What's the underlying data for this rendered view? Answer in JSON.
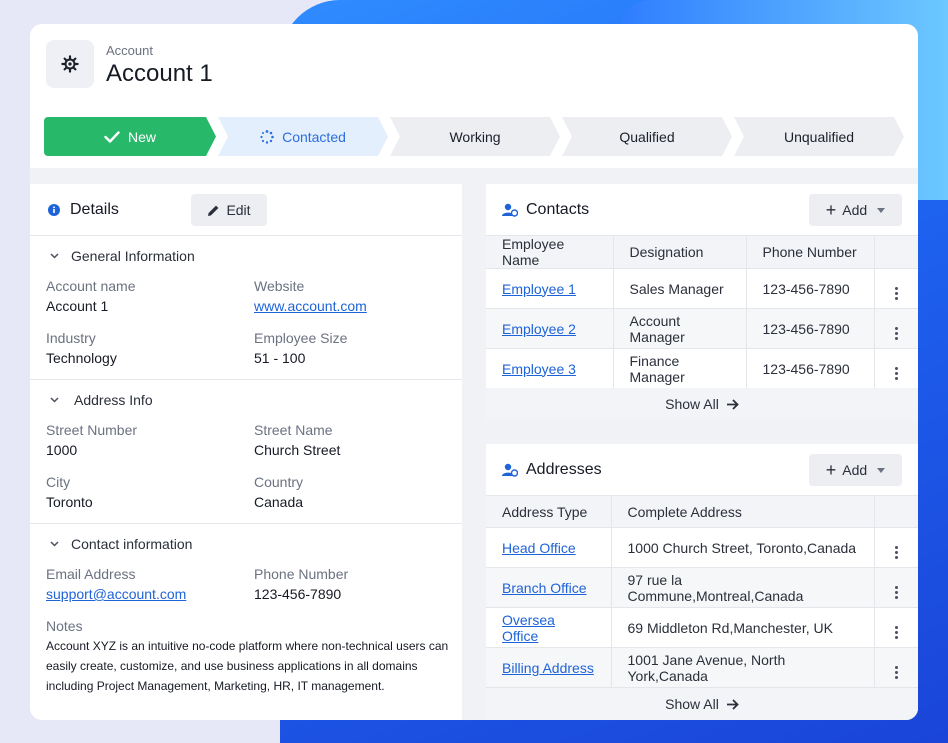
{
  "header": {
    "subtitle": "Account",
    "title": "Account 1"
  },
  "stages": [
    "New",
    "Contacted",
    "Working",
    "Qualified",
    "Unqualified"
  ],
  "details": {
    "title": "Details",
    "edit_label": "Edit",
    "general": {
      "heading": "General Information",
      "account_name_label": "Account name",
      "account_name": "Account 1",
      "website_label": "Website",
      "website": "www.account.com",
      "industry_label": "Industry",
      "industry": "Technology",
      "employee_size_label": "Employee Size",
      "employee_size": "51 - 100"
    },
    "address": {
      "heading": "Address Info",
      "street_number_label": "Street Number",
      "street_number": "1000",
      "street_name_label": "Street Name",
      "street_name": "Church Street",
      "city_label": "City",
      "city": "Toronto",
      "country_label": "Country",
      "country": "Canada"
    },
    "contact": {
      "heading": "Contact information",
      "email_label": "Email Address",
      "email": "support@account.com",
      "phone_label": "Phone Number",
      "phone": "123-456-7890",
      "notes_label": "Notes",
      "notes": "Account XYZ is an intuitive no-code platform where non-technical users can easily create, customize, and use business applications in all domains including Project Management, Marketing, HR, IT management."
    }
  },
  "contacts": {
    "title": "Contacts",
    "add_label": "Add",
    "columns": [
      "Employee Name",
      "Designation",
      "Phone Number"
    ],
    "rows": [
      {
        "name": "Employee 1",
        "designation": "Sales Manager",
        "phone": "123-456-7890"
      },
      {
        "name": "Employee 2",
        "designation": "Account Manager",
        "phone": "123-456-7890"
      },
      {
        "name": "Employee 3",
        "designation": "Finance Manager",
        "phone": "123-456-7890"
      }
    ],
    "show_all": "Show All"
  },
  "addresses": {
    "title": "Addresses",
    "add_label": "Add",
    "columns": [
      "Address Type",
      "Complete Address"
    ],
    "rows": [
      {
        "type": "Head Office",
        "address": "1000 Church Street, Toronto,Canada"
      },
      {
        "type": "Branch Office",
        "address": "97 rue la Commune,Montreal,Canada"
      },
      {
        "type": "Oversea Office",
        "address": "69 Middleton Rd,Manchester, UK"
      },
      {
        "type": "Billing Address",
        "address": "1001 Jane Avenue, North York,Canada"
      }
    ],
    "show_all": "Show All"
  },
  "colors": {
    "accent_green": "#27b86a",
    "accent_blue": "#1e63d8",
    "contacted_bg": "#e3effd"
  }
}
